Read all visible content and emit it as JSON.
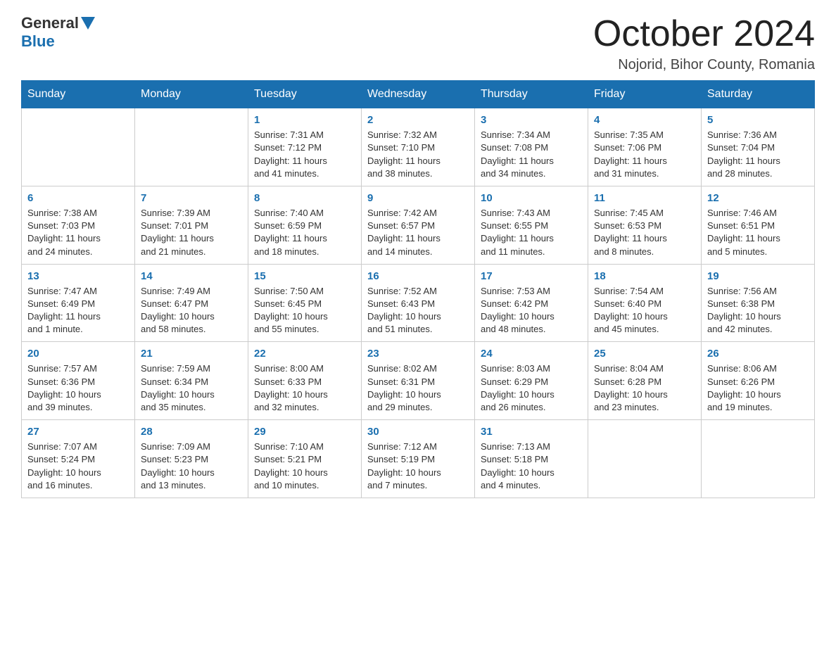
{
  "header": {
    "logo_general": "General",
    "logo_blue": "Blue",
    "month": "October 2024",
    "location": "Nojorid, Bihor County, Romania"
  },
  "weekdays": [
    "Sunday",
    "Monday",
    "Tuesday",
    "Wednesday",
    "Thursday",
    "Friday",
    "Saturday"
  ],
  "weeks": [
    [
      {
        "day": "",
        "info": ""
      },
      {
        "day": "",
        "info": ""
      },
      {
        "day": "1",
        "info": "Sunrise: 7:31 AM\nSunset: 7:12 PM\nDaylight: 11 hours\nand 41 minutes."
      },
      {
        "day": "2",
        "info": "Sunrise: 7:32 AM\nSunset: 7:10 PM\nDaylight: 11 hours\nand 38 minutes."
      },
      {
        "day": "3",
        "info": "Sunrise: 7:34 AM\nSunset: 7:08 PM\nDaylight: 11 hours\nand 34 minutes."
      },
      {
        "day": "4",
        "info": "Sunrise: 7:35 AM\nSunset: 7:06 PM\nDaylight: 11 hours\nand 31 minutes."
      },
      {
        "day": "5",
        "info": "Sunrise: 7:36 AM\nSunset: 7:04 PM\nDaylight: 11 hours\nand 28 minutes."
      }
    ],
    [
      {
        "day": "6",
        "info": "Sunrise: 7:38 AM\nSunset: 7:03 PM\nDaylight: 11 hours\nand 24 minutes."
      },
      {
        "day": "7",
        "info": "Sunrise: 7:39 AM\nSunset: 7:01 PM\nDaylight: 11 hours\nand 21 minutes."
      },
      {
        "day": "8",
        "info": "Sunrise: 7:40 AM\nSunset: 6:59 PM\nDaylight: 11 hours\nand 18 minutes."
      },
      {
        "day": "9",
        "info": "Sunrise: 7:42 AM\nSunset: 6:57 PM\nDaylight: 11 hours\nand 14 minutes."
      },
      {
        "day": "10",
        "info": "Sunrise: 7:43 AM\nSunset: 6:55 PM\nDaylight: 11 hours\nand 11 minutes."
      },
      {
        "day": "11",
        "info": "Sunrise: 7:45 AM\nSunset: 6:53 PM\nDaylight: 11 hours\nand 8 minutes."
      },
      {
        "day": "12",
        "info": "Sunrise: 7:46 AM\nSunset: 6:51 PM\nDaylight: 11 hours\nand 5 minutes."
      }
    ],
    [
      {
        "day": "13",
        "info": "Sunrise: 7:47 AM\nSunset: 6:49 PM\nDaylight: 11 hours\nand 1 minute."
      },
      {
        "day": "14",
        "info": "Sunrise: 7:49 AM\nSunset: 6:47 PM\nDaylight: 10 hours\nand 58 minutes."
      },
      {
        "day": "15",
        "info": "Sunrise: 7:50 AM\nSunset: 6:45 PM\nDaylight: 10 hours\nand 55 minutes."
      },
      {
        "day": "16",
        "info": "Sunrise: 7:52 AM\nSunset: 6:43 PM\nDaylight: 10 hours\nand 51 minutes."
      },
      {
        "day": "17",
        "info": "Sunrise: 7:53 AM\nSunset: 6:42 PM\nDaylight: 10 hours\nand 48 minutes."
      },
      {
        "day": "18",
        "info": "Sunrise: 7:54 AM\nSunset: 6:40 PM\nDaylight: 10 hours\nand 45 minutes."
      },
      {
        "day": "19",
        "info": "Sunrise: 7:56 AM\nSunset: 6:38 PM\nDaylight: 10 hours\nand 42 minutes."
      }
    ],
    [
      {
        "day": "20",
        "info": "Sunrise: 7:57 AM\nSunset: 6:36 PM\nDaylight: 10 hours\nand 39 minutes."
      },
      {
        "day": "21",
        "info": "Sunrise: 7:59 AM\nSunset: 6:34 PM\nDaylight: 10 hours\nand 35 minutes."
      },
      {
        "day": "22",
        "info": "Sunrise: 8:00 AM\nSunset: 6:33 PM\nDaylight: 10 hours\nand 32 minutes."
      },
      {
        "day": "23",
        "info": "Sunrise: 8:02 AM\nSunset: 6:31 PM\nDaylight: 10 hours\nand 29 minutes."
      },
      {
        "day": "24",
        "info": "Sunrise: 8:03 AM\nSunset: 6:29 PM\nDaylight: 10 hours\nand 26 minutes."
      },
      {
        "day": "25",
        "info": "Sunrise: 8:04 AM\nSunset: 6:28 PM\nDaylight: 10 hours\nand 23 minutes."
      },
      {
        "day": "26",
        "info": "Sunrise: 8:06 AM\nSunset: 6:26 PM\nDaylight: 10 hours\nand 19 minutes."
      }
    ],
    [
      {
        "day": "27",
        "info": "Sunrise: 7:07 AM\nSunset: 5:24 PM\nDaylight: 10 hours\nand 16 minutes."
      },
      {
        "day": "28",
        "info": "Sunrise: 7:09 AM\nSunset: 5:23 PM\nDaylight: 10 hours\nand 13 minutes."
      },
      {
        "day": "29",
        "info": "Sunrise: 7:10 AM\nSunset: 5:21 PM\nDaylight: 10 hours\nand 10 minutes."
      },
      {
        "day": "30",
        "info": "Sunrise: 7:12 AM\nSunset: 5:19 PM\nDaylight: 10 hours\nand 7 minutes."
      },
      {
        "day": "31",
        "info": "Sunrise: 7:13 AM\nSunset: 5:18 PM\nDaylight: 10 hours\nand 4 minutes."
      },
      {
        "day": "",
        "info": ""
      },
      {
        "day": "",
        "info": ""
      }
    ]
  ]
}
